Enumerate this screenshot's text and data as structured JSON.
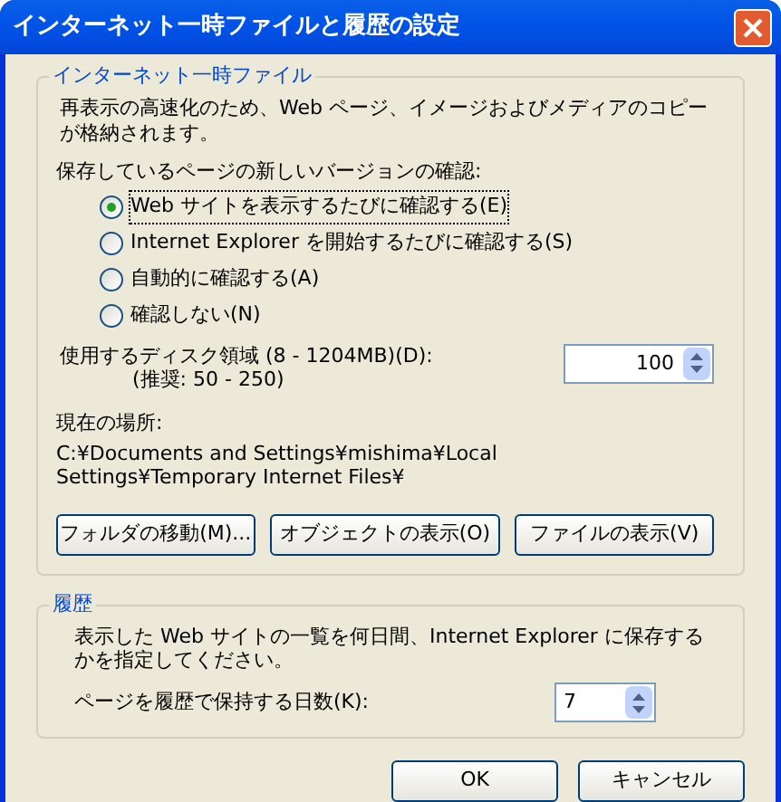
{
  "window": {
    "title": "インターネット一時ファイルと履歴の設定"
  },
  "temp_files": {
    "legend": "インターネット一時ファイル",
    "description": "再表示の高速化のため、Web ページ、イメージおよびメディアのコピーが格納されます。",
    "check_label": "保存しているページの新しいバージョンの確認:",
    "options": [
      {
        "label": "Web サイトを表示するたびに確認する(E)",
        "selected": true
      },
      {
        "label": "Internet Explorer を開始するたびに確認する(S)",
        "selected": false
      },
      {
        "label": "自動的に確認する(A)",
        "selected": false
      },
      {
        "label": "確認しない(N)",
        "selected": false
      }
    ],
    "disk_label": "使用するディスク領域 (8 - 1204MB)(D):",
    "disk_hint": "(推奨: 50 - 250)",
    "disk_value": "100",
    "location_label": "現在の場所:",
    "location": "C:¥Documents and Settings¥mishima¥Local Settings¥Temporary Internet Files¥",
    "buttons": [
      "フォルダの移動(M)...",
      "オブジェクトの表示(O)",
      "ファイルの表示(V)"
    ]
  },
  "history": {
    "legend": "履歴",
    "description": "表示した Web サイトの一覧を何日間、Internet Explorer に保存するかを指定してください。",
    "days_label": "ページを履歴で保持する日数(K):",
    "days_value": "7"
  },
  "buttons": [
    "OK",
    "キャンセル"
  ]
}
